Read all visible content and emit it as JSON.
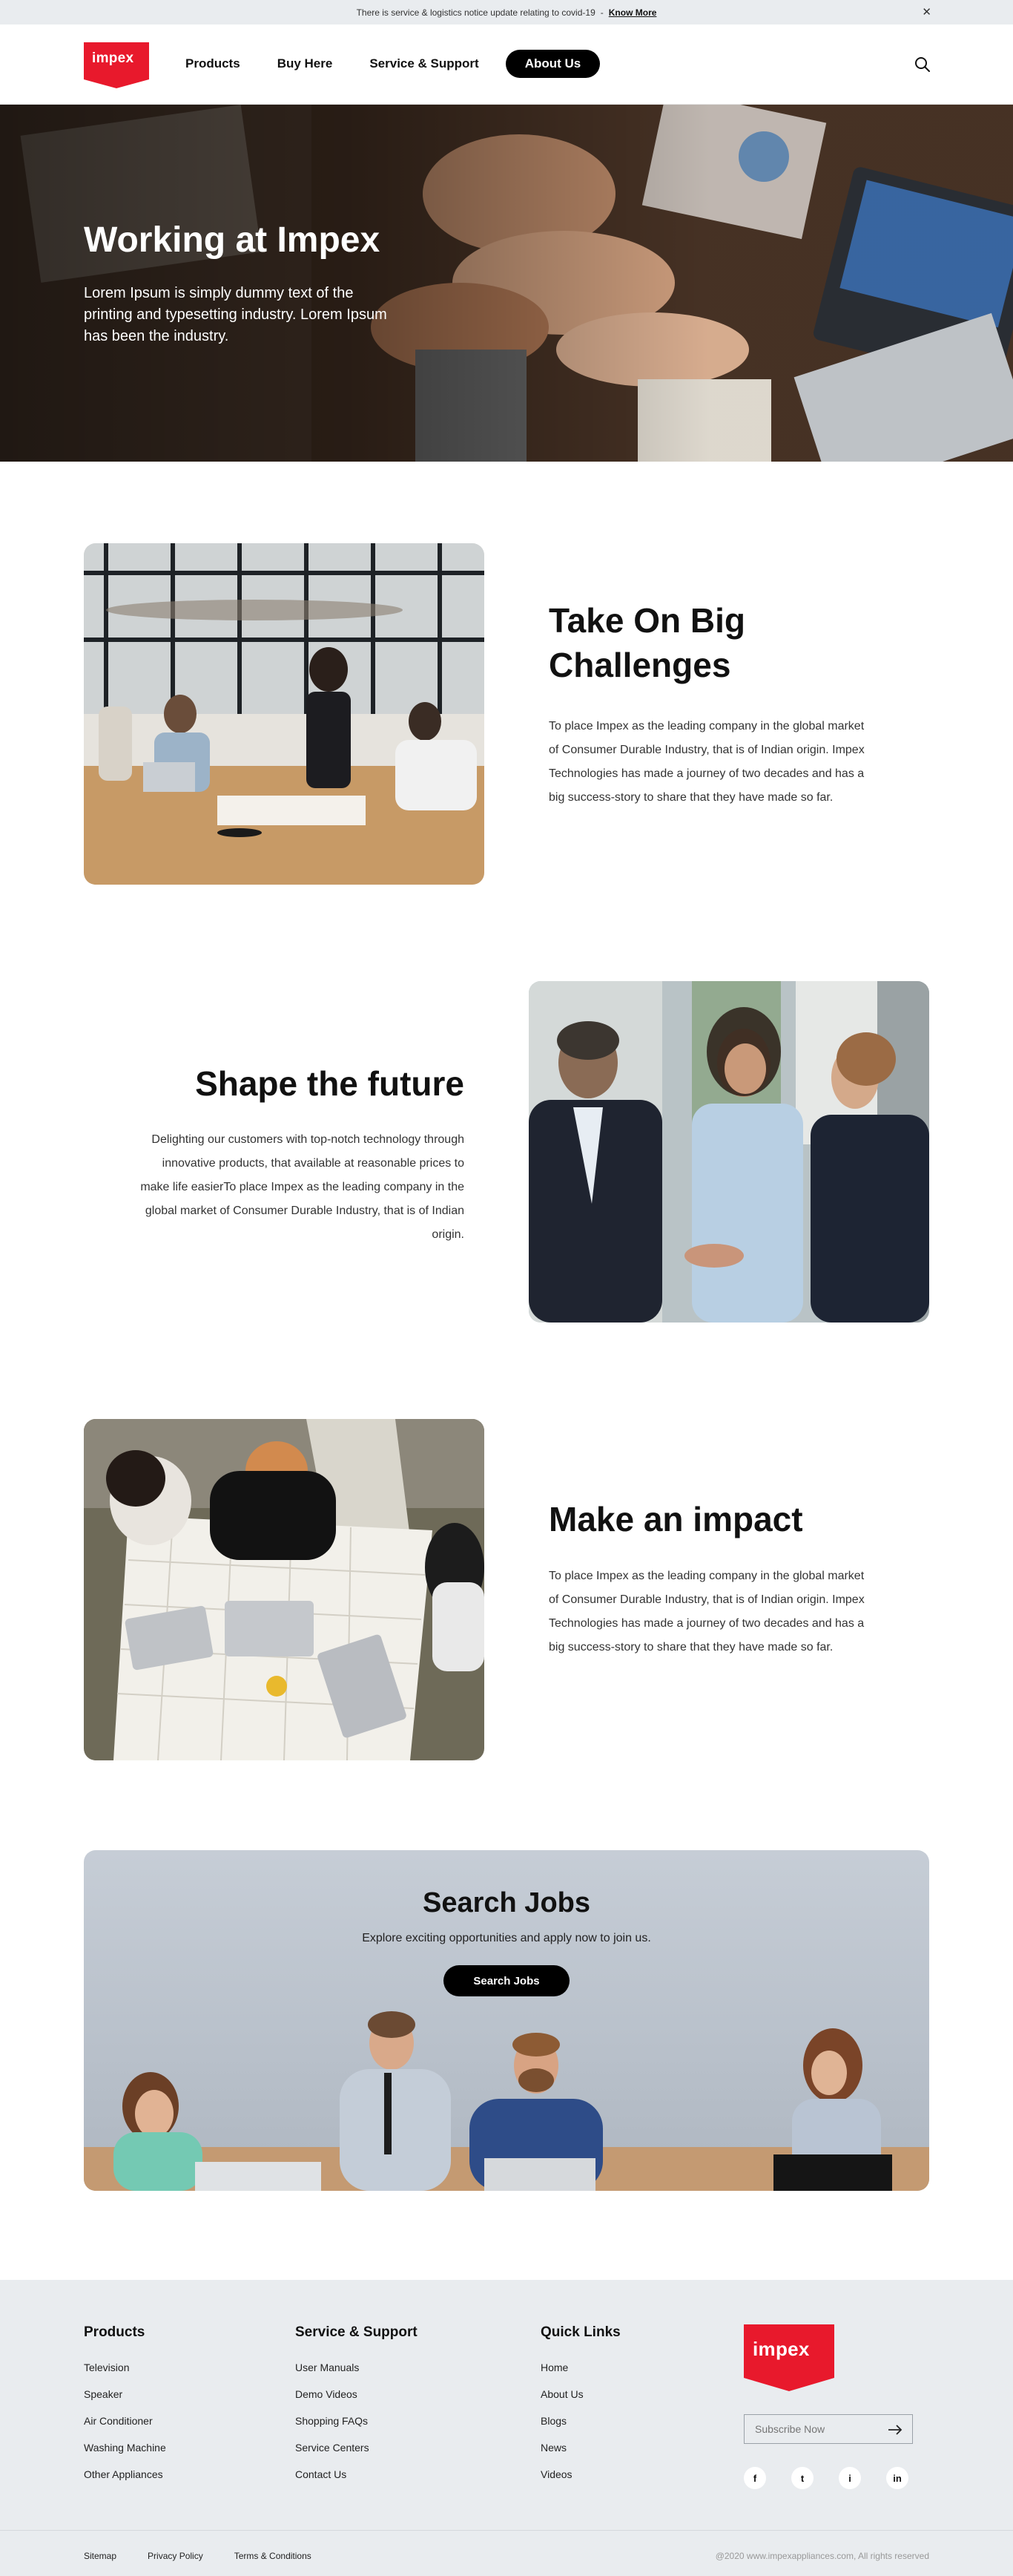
{
  "notice": {
    "text": "There is service & logistics notice update relating to covid-19",
    "separator": "-",
    "link": "Know More",
    "close_icon": "close-icon"
  },
  "header": {
    "logo_text": "impex",
    "nav": [
      "Products",
      "Buy Here",
      "Service & Support",
      "About Us"
    ],
    "active_nav": "About Us",
    "search_icon": "search-icon"
  },
  "hero": {
    "title": "Working at Impex",
    "text": "Lorem Ipsum is simply dummy text of the printing and typesetting industry. Lorem Ipsum has been the industry."
  },
  "sections": [
    {
      "title": "Take On Big Challenges",
      "text": "To place Impex as the leading company in the global market of Consumer Durable Industry, that is of Indian origin. Impex Technologies has made a journey of two decades and has a big success-story to share that they have made so far."
    },
    {
      "title": "Shape the future",
      "text": "Delighting our customers with top-notch technology through innovative products, that available at reasonable prices to make life easierTo place Impex as the leading company in the global market of Consumer Durable Industry, that is of Indian origin."
    },
    {
      "title": "Make an impact",
      "text": "To place Impex as the leading company in the global market of Consumer Durable Industry, that is of Indian origin. Impex Technologies has made a journey of two decades and has a big success-story to share that they have made so far."
    }
  ],
  "jobs": {
    "title": "Search Jobs",
    "subtitle": "Explore exciting opportunities and apply now to join us.",
    "button": "Search Jobs"
  },
  "footer": {
    "columns": [
      {
        "heading": "Products",
        "links": [
          "Television",
          "Speaker",
          "Air Conditioner",
          "Washing Machine",
          "Other Appliances"
        ]
      },
      {
        "heading": "Service & Support",
        "links": [
          "User Manuals",
          "Demo Videos",
          "Shopping FAQs",
          "Service Centers",
          "Contact Us"
        ]
      },
      {
        "heading": "Quick Links",
        "links": [
          "Home",
          "About Us",
          "Blogs",
          "News",
          "Videos"
        ]
      }
    ],
    "logo_text": "impex",
    "subscribe_placeholder": "Subscribe Now",
    "socials": [
      "f",
      "t",
      "i",
      "in"
    ],
    "bottom_links": [
      "Sitemap",
      "Privacy Policy",
      "Terms & Conditions"
    ],
    "copyright": "@2020 www.impexappliances.com, All rights reserved"
  },
  "colors": {
    "brand_red": "#e8192c",
    "black": "#000000",
    "footer_bg": "#e9ecef"
  }
}
